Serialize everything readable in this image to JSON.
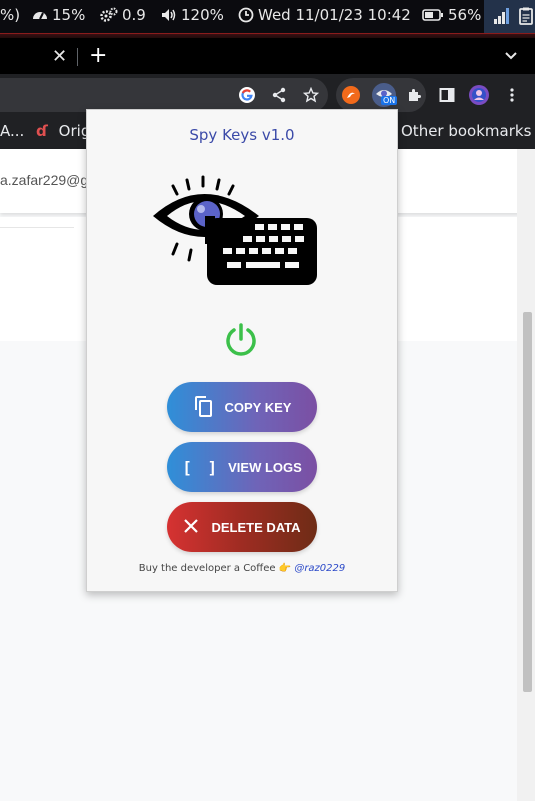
{
  "system_bar": {
    "left_fragment": "%)",
    "cpu": "15%",
    "load": "0.9",
    "volume": "120%",
    "datetime": "Wed 11/01/23 10:42",
    "battery": "56%"
  },
  "browser": {
    "bookmarks": {
      "item1": "A...",
      "item2": "Origi",
      "other": "Other bookmarks"
    },
    "extension_badge": "ON"
  },
  "page": {
    "email_fragment": "a.zafar229@g"
  },
  "popup": {
    "title": "Spy Keys v1.0",
    "buttons": {
      "copy_key": "COPY KEY",
      "view_logs": "VIEW LOGS",
      "delete_data": "DELETE DATA"
    },
    "footer_text": "Buy the developer a Coffee 👉",
    "footer_handle": "@raz0229"
  },
  "colors": {
    "title": "#3b4aa8",
    "power_on": "#3cc04a",
    "button_blue_start": "#2f8fd8",
    "button_blue_end": "#7b4fa3",
    "button_red_start": "#d63232",
    "button_red_end": "#6e2c16",
    "logo_iris": "#5b63c8"
  }
}
